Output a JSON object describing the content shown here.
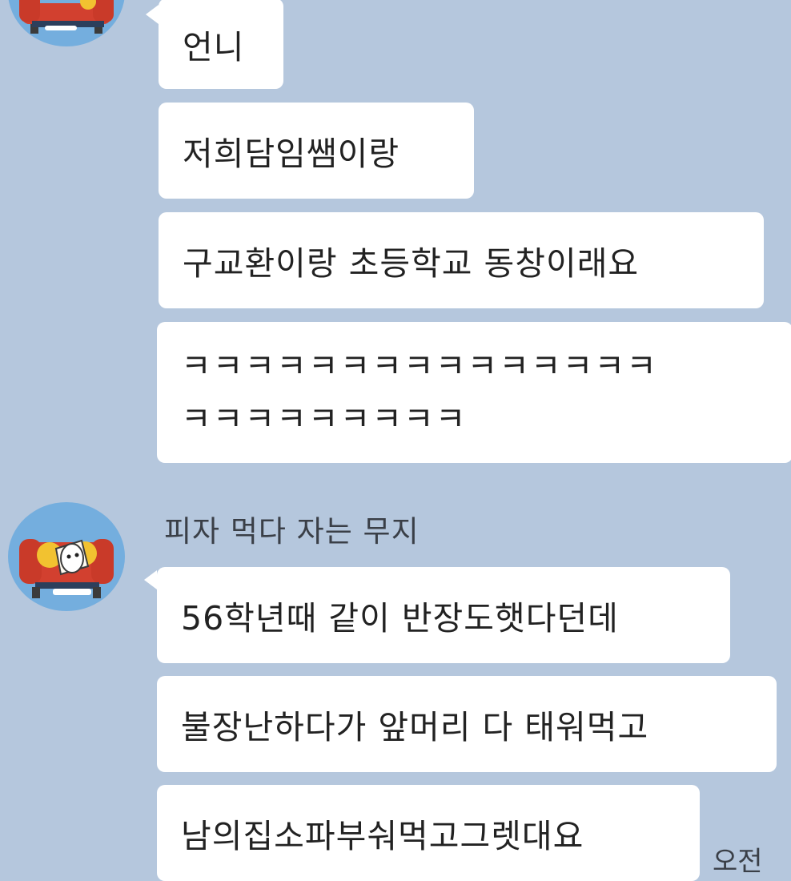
{
  "chat": {
    "first_group": {
      "messages": [
        "언니",
        "저희담임쌤이랑",
        "구교환이랑 초등학교 동창이래요"
      ],
      "laugh_lines": [
        "ㅋㅋㅋㅋㅋㅋㅋㅋㅋㅋㅋㅋㅋㅋㅋ",
        "ㅋㅋㅋㅋㅋㅋㅋㅋㅋ"
      ]
    },
    "second_group": {
      "sender_name": "피자 먹다 자는 무지",
      "messages": [
        "56학년때 같이 반장도햇다던데",
        "불장난하다가 앞머리 다 태워먹고",
        "남의집소파부숴먹고그렛대요"
      ],
      "timestamp": "오전"
    }
  },
  "colors": {
    "background": "#b5c7dd",
    "bubble": "#ffffff",
    "avatar_bg": "#74aede"
  },
  "icons": {
    "avatar": "muzi-on-sofa-avatar"
  }
}
